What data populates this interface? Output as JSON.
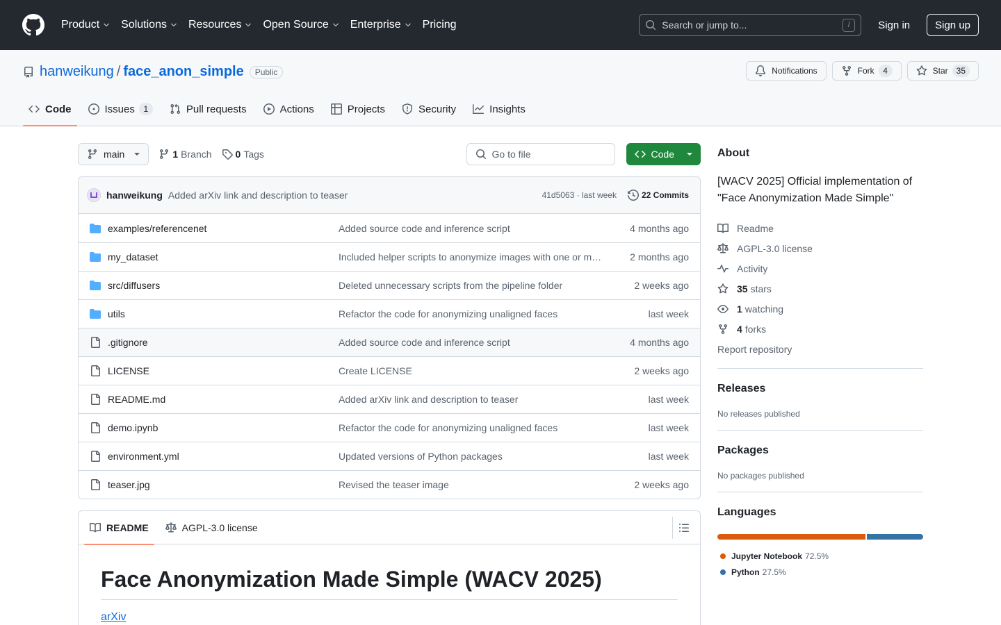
{
  "header": {
    "nav": [
      "Product",
      "Solutions",
      "Resources",
      "Open Source",
      "Enterprise",
      "Pricing"
    ],
    "search_placeholder": "Search or jump to...",
    "search_shortcut": "/",
    "sign_in": "Sign in",
    "sign_up": "Sign up"
  },
  "repo": {
    "owner": "hanweikung",
    "separator": "/",
    "name": "face_anon_simple",
    "visibility": "Public",
    "notifications_label": "Notifications",
    "fork_label": "Fork",
    "fork_count": "4",
    "star_label": "Star",
    "star_count": "35",
    "tabs": [
      {
        "label": "Code",
        "icon": "code-icon"
      },
      {
        "label": "Issues",
        "icon": "issue-icon",
        "count": "1"
      },
      {
        "label": "Pull requests",
        "icon": "pull-request-icon"
      },
      {
        "label": "Actions",
        "icon": "play-icon"
      },
      {
        "label": "Projects",
        "icon": "table-icon"
      },
      {
        "label": "Security",
        "icon": "shield-icon"
      },
      {
        "label": "Insights",
        "icon": "graph-icon"
      }
    ]
  },
  "toolbar": {
    "branch": "main",
    "branch_count": "1",
    "branch_label": "Branch",
    "tag_count": "0",
    "tag_label": "Tags",
    "goto_placeholder": "Go to file",
    "code_button": "Code"
  },
  "latest_commit": {
    "author": "hanweikung",
    "message": "Added arXiv link and description to teaser",
    "hash_age": "41d5063 · last week",
    "commits_label": "22 Commits"
  },
  "files": [
    {
      "name": "examples/referencenet",
      "type": "dir",
      "message": "Added source code and inference script",
      "age": "4 months ago"
    },
    {
      "name": "my_dataset",
      "type": "dir",
      "message": "Included helper scripts to anonymize images with one or m…",
      "age": "2 months ago"
    },
    {
      "name": "src/diffusers",
      "type": "dir",
      "message": "Deleted unnecessary scripts from the pipeline folder",
      "age": "2 weeks ago"
    },
    {
      "name": "utils",
      "type": "dir",
      "message": "Refactor the code for anonymizing unaligned faces",
      "age": "last week"
    },
    {
      "name": ".gitignore",
      "type": "file",
      "message": "Added source code and inference script",
      "age": "4 months ago"
    },
    {
      "name": "LICENSE",
      "type": "file",
      "message": "Create LICENSE",
      "age": "2 weeks ago"
    },
    {
      "name": "README.md",
      "type": "file",
      "message": "Added arXiv link and description to teaser",
      "age": "last week"
    },
    {
      "name": "demo.ipynb",
      "type": "file",
      "message": "Refactor the code for anonymizing unaligned faces",
      "age": "last week"
    },
    {
      "name": "environment.yml",
      "type": "file",
      "message": "Updated versions of Python packages",
      "age": "last week"
    },
    {
      "name": "teaser.jpg",
      "type": "file",
      "message": "Revised the teaser image",
      "age": "2 weeks ago"
    }
  ],
  "readme": {
    "tab_readme": "README",
    "tab_license": "AGPL-3.0 license",
    "heading": "Face Anonymization Made Simple (WACV 2025)",
    "link": "arXiv"
  },
  "about": {
    "title": "About",
    "description": "[WACV 2025] Official implementation of \"Face Anonymization Made Simple\"",
    "readme": "Readme",
    "license": "AGPL-3.0 license",
    "activity": "Activity",
    "stars_count": "35",
    "stars_label": "stars",
    "watching_count": "1",
    "watching_label": "watching",
    "forks_count": "4",
    "forks_label": "forks",
    "report": "Report repository"
  },
  "releases": {
    "title": "Releases",
    "note": "No releases published"
  },
  "packages": {
    "title": "Packages",
    "note": "No packages published"
  },
  "languages": {
    "title": "Languages",
    "items": [
      {
        "name": "Jupyter Notebook",
        "percent": "72.5%",
        "value": 72.5,
        "color": "#DA5B0B"
      },
      {
        "name": "Python",
        "percent": "27.5%",
        "value": 27.5,
        "color": "#3572A5"
      }
    ]
  }
}
